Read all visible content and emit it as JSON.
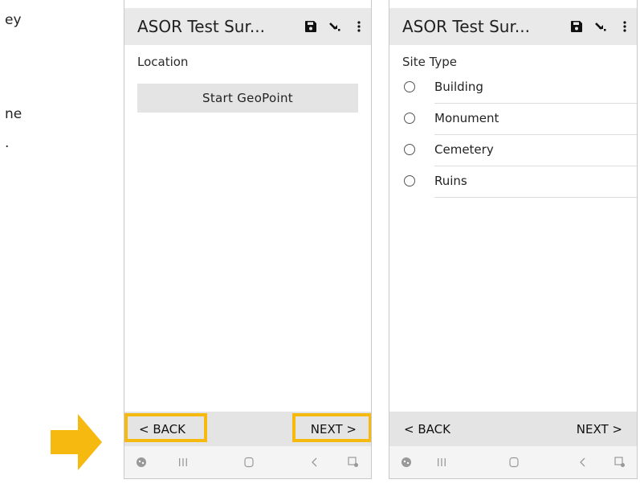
{
  "colors": {
    "accent_highlight": "#f6b90f",
    "app_bar": "#e9e9e9",
    "nav_bar": "#e4e4e4"
  },
  "page_edge_text": [
    "ey",
    "ne",
    "."
  ],
  "screens": [
    {
      "title": "ASOR Test Sur...",
      "actions": [
        "save-icon",
        "jump-icon",
        "more-vert-icon"
      ],
      "field_label": "Location",
      "geo_button": "Start GeoPoint",
      "back": "< BACK",
      "next": "NEXT >"
    },
    {
      "title": "ASOR Test Sur...",
      "actions": [
        "save-icon",
        "jump-icon",
        "more-vert-icon"
      ],
      "field_label": "Site Type",
      "options": [
        "Building",
        "Monument",
        "Cemetery",
        "Ruins"
      ],
      "back": "< BACK",
      "next": "NEXT >"
    }
  ],
  "system_nav": [
    "assistant-icon",
    "recents-icon",
    "home-icon",
    "back-icon",
    "screenshot-icon"
  ]
}
